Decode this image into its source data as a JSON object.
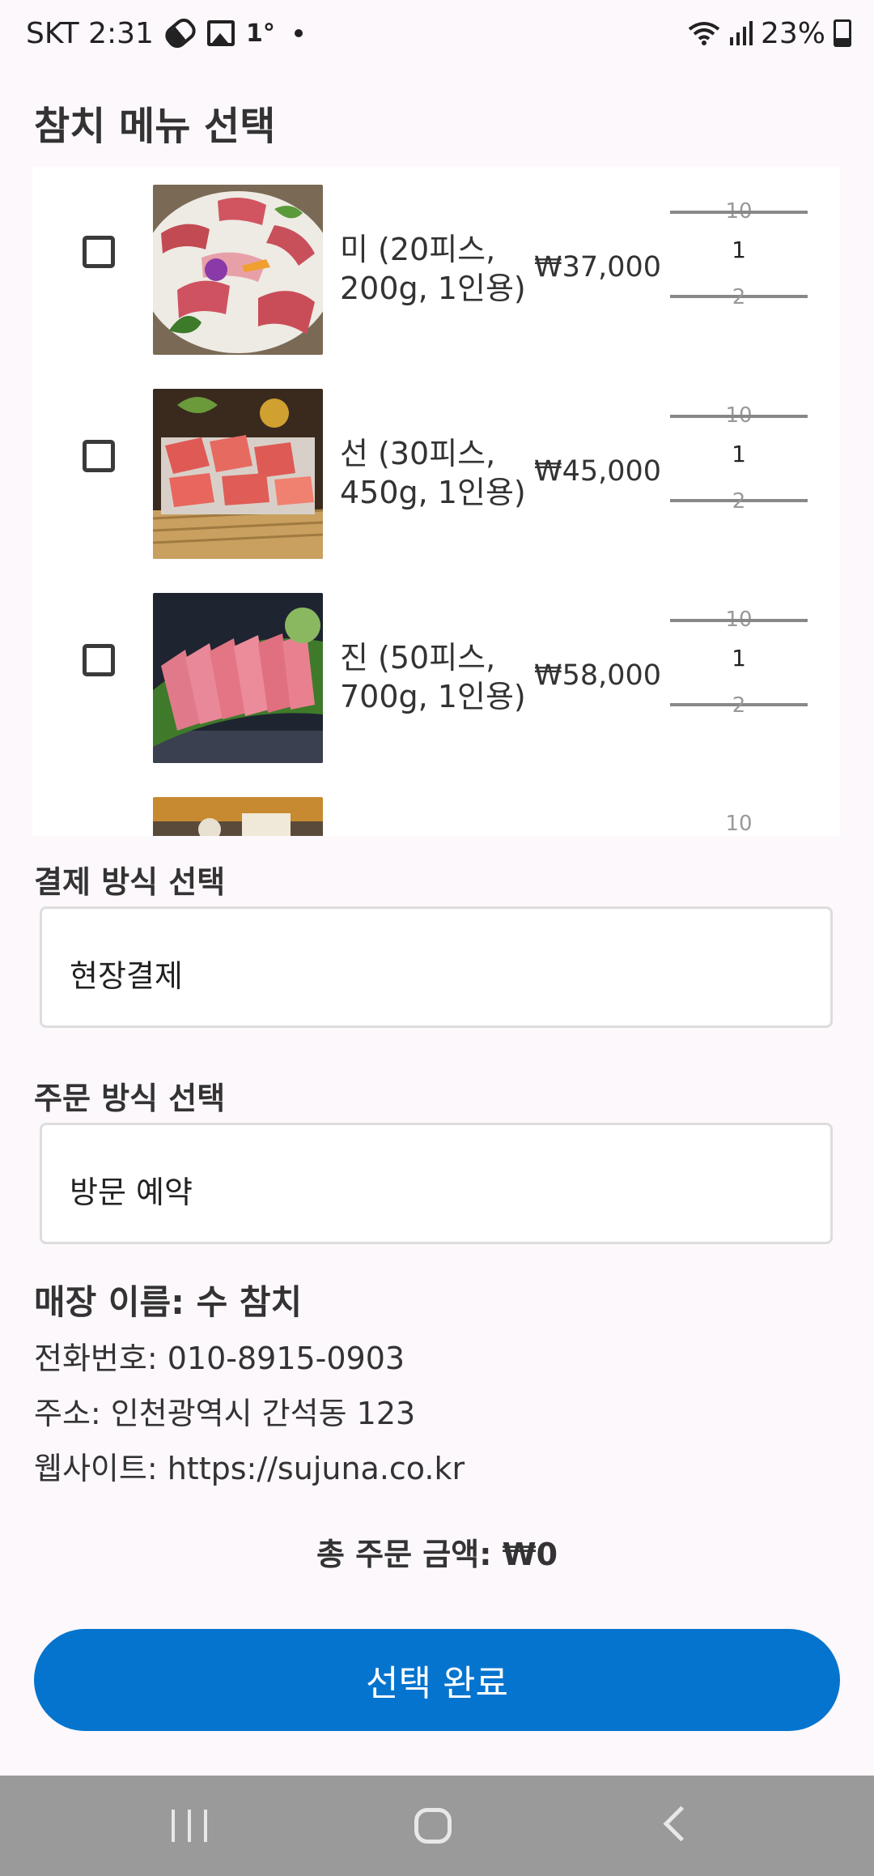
{
  "status_bar": {
    "carrier_time": "SKT 2:31",
    "temp": "1°",
    "battery": "23%"
  },
  "header": {
    "title": "참치 메뉴 선택"
  },
  "menu": {
    "items": [
      {
        "name": "미 (20피스, 200g, 1인용)",
        "price": "₩37,000",
        "qty_prev": "10",
        "qty": "1",
        "qty_next": "2"
      },
      {
        "name": "선 (30피스, 450g, 1인용)",
        "price": "₩45,000",
        "qty_prev": "10",
        "qty": "1",
        "qty_next": "2"
      },
      {
        "name": "진 (50피스, 700g, 1인용)",
        "price": "₩58,000",
        "qty_prev": "10",
        "qty": "1",
        "qty_next": "2"
      },
      {
        "qty_prev": "10"
      }
    ]
  },
  "payment": {
    "label": "결제 방식 선택",
    "value": "현장결제"
  },
  "order": {
    "label": "주문 방식 선택",
    "value": "방문 예약"
  },
  "store": {
    "name": "매장 이름: 수 참치",
    "phone": "전화번호: 010-8915-0903",
    "address": "주소: 인천광역시 간석동 123",
    "website": "웹사이트: https://sujuna.co.kr"
  },
  "total": "총 주문 금액: ₩0",
  "submit_label": "선택 완료"
}
